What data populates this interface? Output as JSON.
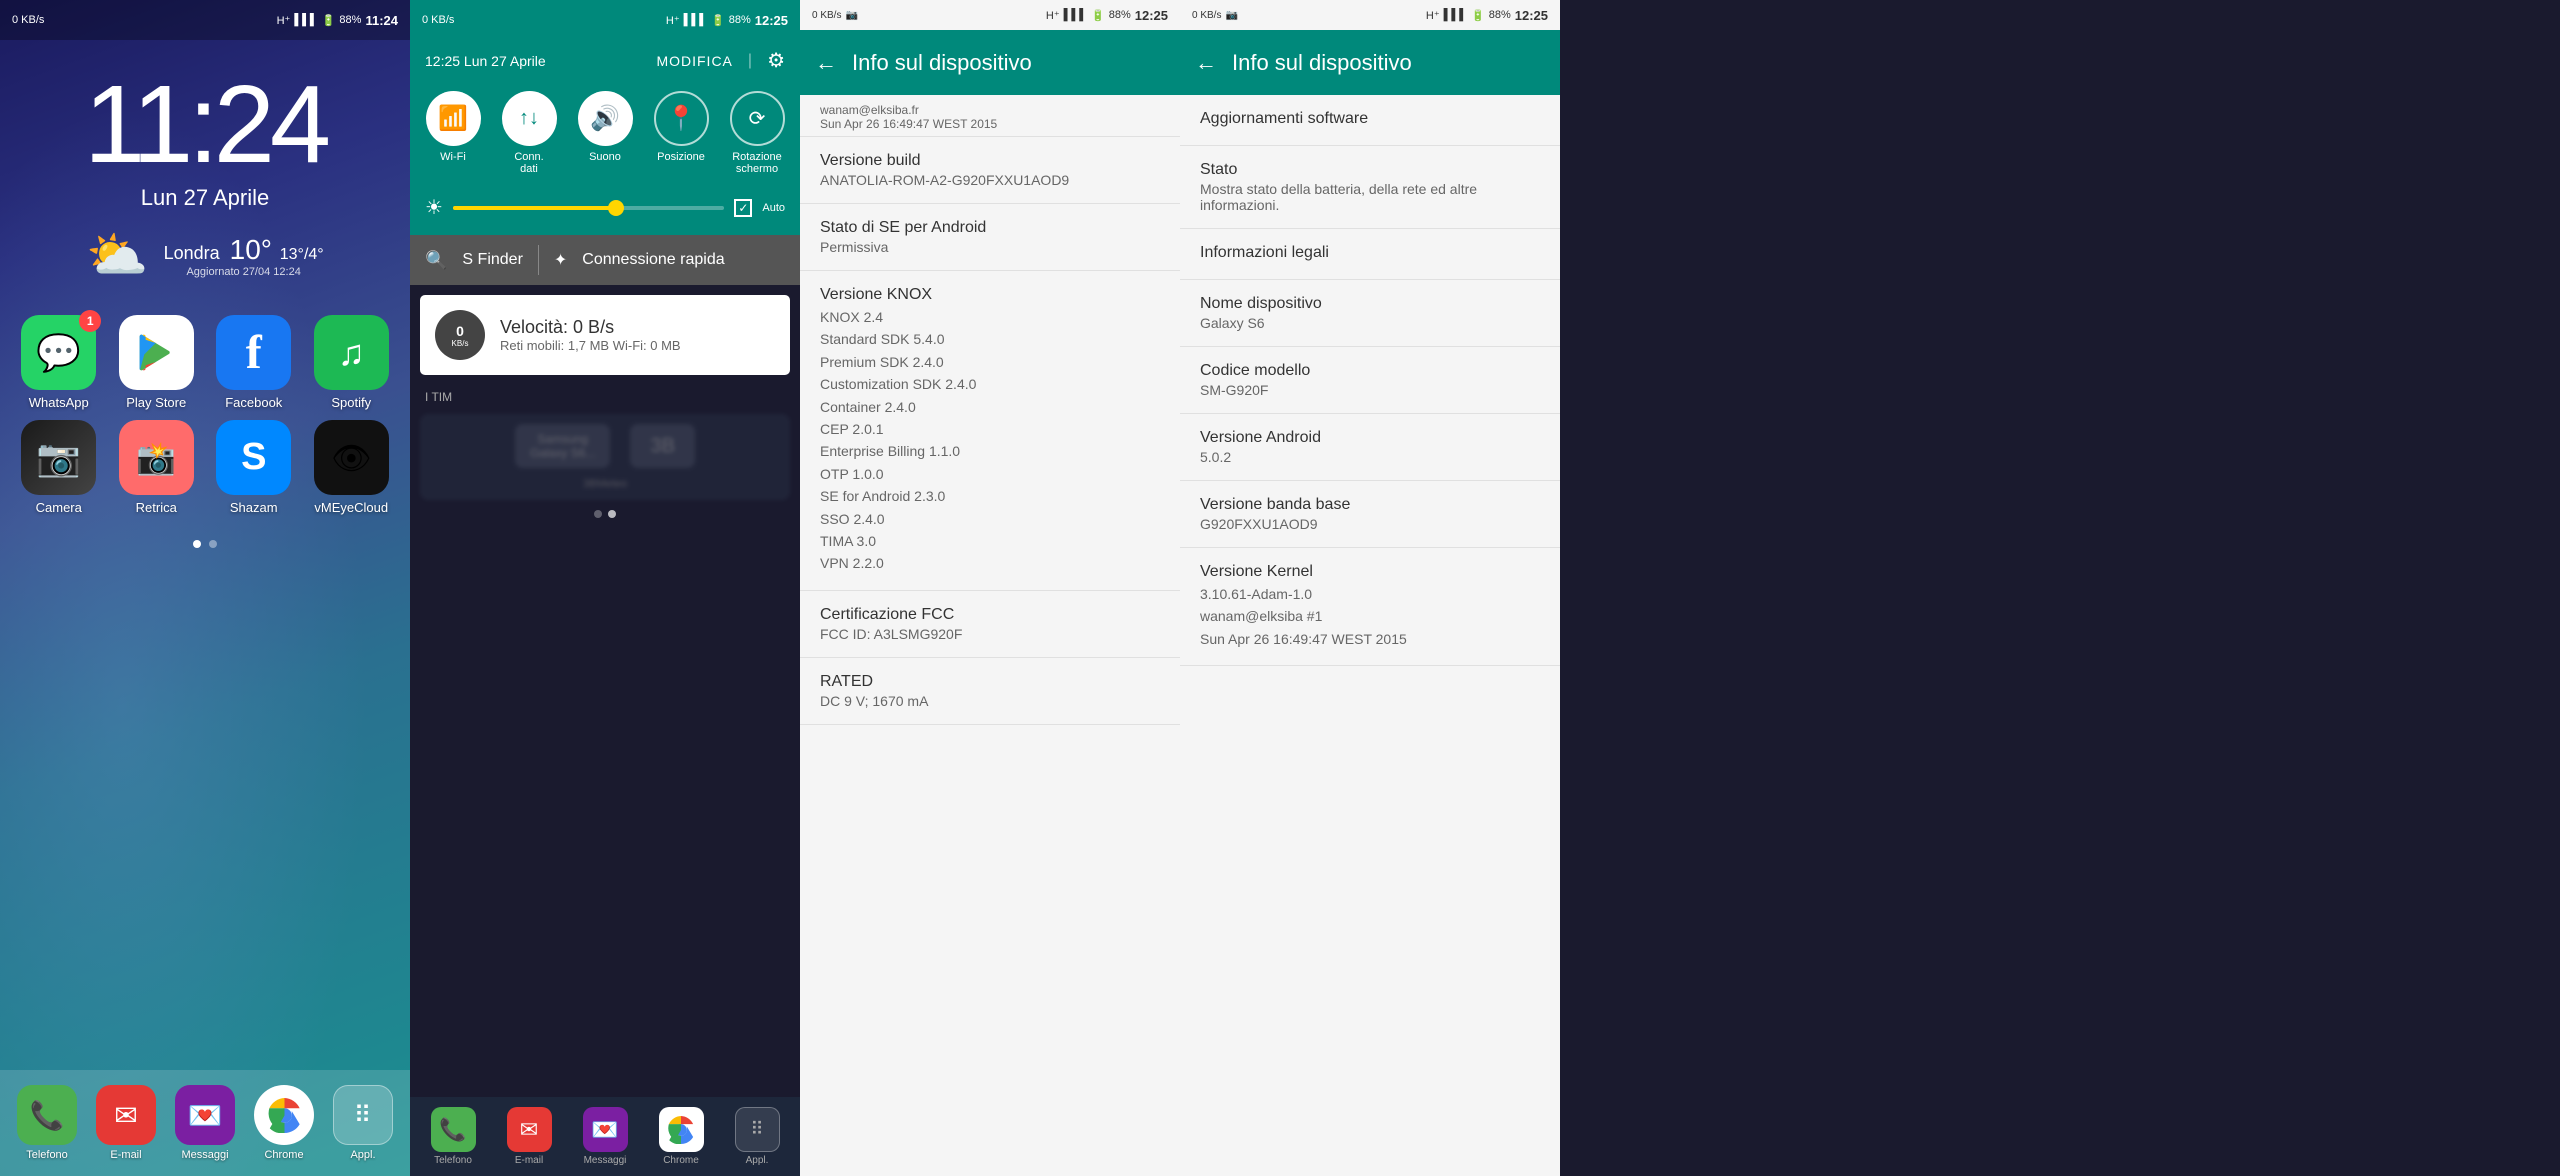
{
  "panel1": {
    "status": {
      "left": "0 KB/s",
      "signal": "H+",
      "battery": "88%",
      "time": "11:24"
    },
    "clock": {
      "time": "11:24",
      "date": "Lun 27 Aprile"
    },
    "weather": {
      "city": "Londra",
      "temp": "10°",
      "high": "13°",
      "low": "4°",
      "updated": "Aggiornato 27/04  12:24"
    },
    "apps": [
      {
        "name": "WhatsApp",
        "label": "WhatsApp",
        "badge": "1",
        "color": "#25D366",
        "icon": "💬"
      },
      {
        "name": "Play Store",
        "label": "Play Store",
        "color": "white",
        "icon": "▶"
      },
      {
        "name": "Facebook",
        "label": "Facebook",
        "color": "#1877F2",
        "icon": "f"
      },
      {
        "name": "Spotify",
        "label": "Spotify",
        "color": "#1DB954",
        "icon": "♫"
      },
      {
        "name": "Camera",
        "label": "Camera",
        "color": "#222",
        "icon": "📷"
      },
      {
        "name": "Retrica",
        "label": "Retrica",
        "color": "#ff6b6b",
        "icon": "🔴"
      },
      {
        "name": "Shazam",
        "label": "Shazam",
        "color": "#0088FF",
        "icon": "S"
      },
      {
        "name": "vMEyeCloud",
        "label": "vMEyeCloud",
        "color": "#111",
        "icon": "👁"
      }
    ],
    "dock": [
      {
        "name": "Telefono",
        "label": "Telefono",
        "icon": "📞",
        "color": "#4CAF50"
      },
      {
        "name": "E-mail",
        "label": "E-mail",
        "icon": "✉",
        "color": "#E53935"
      },
      {
        "name": "Messaggi",
        "label": "Messaggi",
        "icon": "💌",
        "color": "#7B1FA2"
      },
      {
        "name": "Chrome",
        "label": "Chrome",
        "icon": "🌐",
        "color": "#fff"
      },
      {
        "name": "Appl",
        "label": "Appl.",
        "icon": "⠿",
        "color": "#333"
      }
    ]
  },
  "panel2": {
    "status": {
      "left": "0 KB/s",
      "signal": "H+",
      "battery": "88%",
      "time": "12:25"
    },
    "header": {
      "date": "12:25  Lun 27 Aprile",
      "modifica": "MODIFICA",
      "gear": "⚙"
    },
    "toggles": [
      {
        "name": "Wi-Fi",
        "label": "Wi-Fi",
        "icon": "📶",
        "active": true
      },
      {
        "name": "Conn. dati",
        "label": "Conn.\ndati",
        "icon": "↕",
        "active": true
      },
      {
        "name": "Suono",
        "label": "Suono",
        "icon": "🔊",
        "active": true
      },
      {
        "name": "Posizione",
        "label": "Posizione",
        "icon": "📍",
        "active": false
      },
      {
        "name": "Rotazione schermo",
        "label": "Rotazione\nschermo",
        "icon": "⟲",
        "active": false
      }
    ],
    "brightness": {
      "value": 60,
      "auto": "Auto"
    },
    "search": {
      "sfinder": "S Finder",
      "connessione": "Connessione rapida"
    },
    "speed": {
      "kbs": "0",
      "unit": "KB/s",
      "title": "Velocità: 0 B/s",
      "subtitle": "Reti mobili: 1,7 MB   Wi-Fi: 0 MB"
    },
    "tim": "I TIM",
    "blurred_apps": [
      {
        "label": "Samsung\nGalaxy S6...",
        "icon": "📱"
      },
      {
        "label": "3BMeteo",
        "icon": "🌤"
      }
    ],
    "dock": [
      {
        "label": "Telefono",
        "icon": "📞"
      },
      {
        "label": "E-mail",
        "icon": "✉"
      },
      {
        "label": "Messaggi",
        "icon": "💌"
      },
      {
        "label": "Chrome",
        "icon": "🌐"
      },
      {
        "label": "Appl.",
        "icon": "⠿"
      }
    ]
  },
  "panel3": {
    "status": {
      "left": "0 KB/s",
      "signal": "H+",
      "battery": "88%",
      "time": "12:25"
    },
    "header": {
      "back": "←",
      "title": "Info sul dispositivo"
    },
    "items": [
      {
        "label": "wanam@elksiba.fr",
        "value": "Sun Apr 26 16:49:47 WEST 2015",
        "is_top": true
      },
      {
        "label": "Versione build",
        "value": "ANATOLIA-ROM-A2-G920FXXU1AOD9"
      },
      {
        "label": "Stato di SE per Android",
        "value": "Permissiva"
      },
      {
        "label": "Versione KNOX",
        "value": "KNOX 2.4\nStandard SDK 5.4.0\nPremium SDK 2.4.0\nCustomization SDK 2.4.0\nContainer 2.4.0\nCEP 2.0.1\nEnterprise Billing 1.1.0\nOTP 1.0.0\nSE for Android 2.3.0\nSSO 2.4.0\nTIMA 3.0\nVPN 2.2.0"
      },
      {
        "label": "Certificazione FCC",
        "value": "FCC ID: A3LSMG920F"
      },
      {
        "label": "RATED",
        "value": "DC 9 V; 1670 mA"
      }
    ]
  },
  "panel4": {
    "status": {
      "left": "0 KB/s",
      "signal": "H+",
      "battery": "88%",
      "time": "12:25"
    },
    "header": {
      "back": "←",
      "title": "Info sul dispositivo"
    },
    "items": [
      {
        "label": "Aggiornamenti software",
        "value": ""
      },
      {
        "label": "Stato",
        "value": "Mostra stato della batteria, della rete ed altre informazioni."
      },
      {
        "label": "Informazioni legali",
        "value": ""
      },
      {
        "label": "Nome dispositivo",
        "value": "Galaxy S6"
      },
      {
        "label": "Codice modello",
        "value": "SM-G920F"
      },
      {
        "label": "Versione Android",
        "value": "5.0.2"
      },
      {
        "label": "Versione banda base",
        "value": "G920FXXU1AOD9"
      },
      {
        "label": "Versione Kernel",
        "value": "3.10.61-Adam-1.0\nwanam@elksiba #1\nSun Apr 26 16:49:47 WEST 2015"
      }
    ]
  }
}
